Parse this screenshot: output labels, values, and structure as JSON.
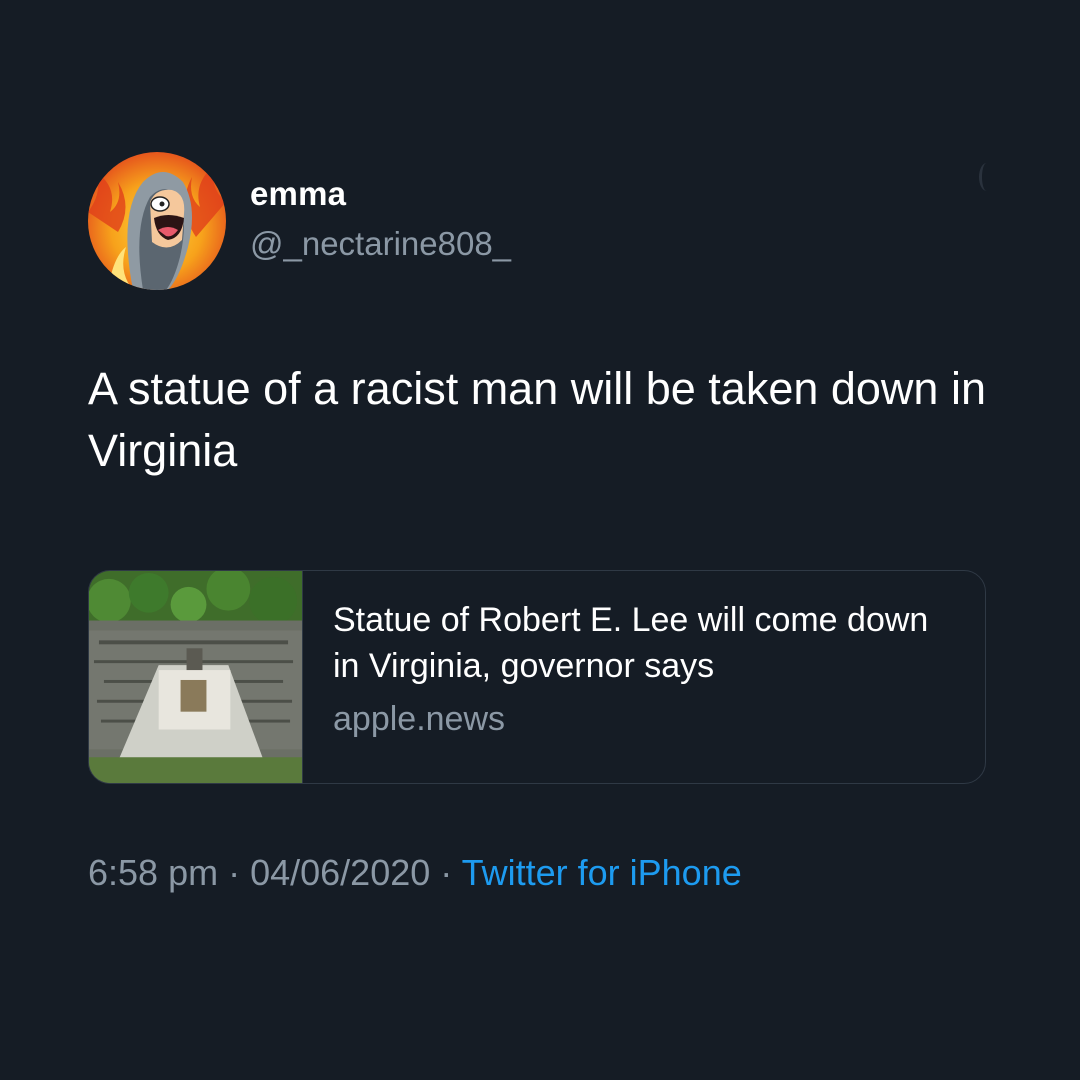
{
  "tweet": {
    "author": {
      "display_name": "emma",
      "handle": "@_nectarine808_",
      "avatar_icon": "cartoon-avatar-icon"
    },
    "text": "A statue of a racist man will be taken down in Virginia",
    "link_card": {
      "title": "Statue of Robert E. Lee will come down in Virginia, governor says",
      "domain": "apple.news",
      "thumbnail_icon": "statue-aerial-photo"
    },
    "meta": {
      "time": "6:58 pm",
      "separator": " · ",
      "date": "04/06/2020",
      "source": "Twitter for iPhone"
    }
  },
  "colors": {
    "background": "#151c25",
    "primary_text": "#ffffff",
    "secondary_text": "#8b98a5",
    "link": "#1d9bf0",
    "border": "#2f3945"
  }
}
